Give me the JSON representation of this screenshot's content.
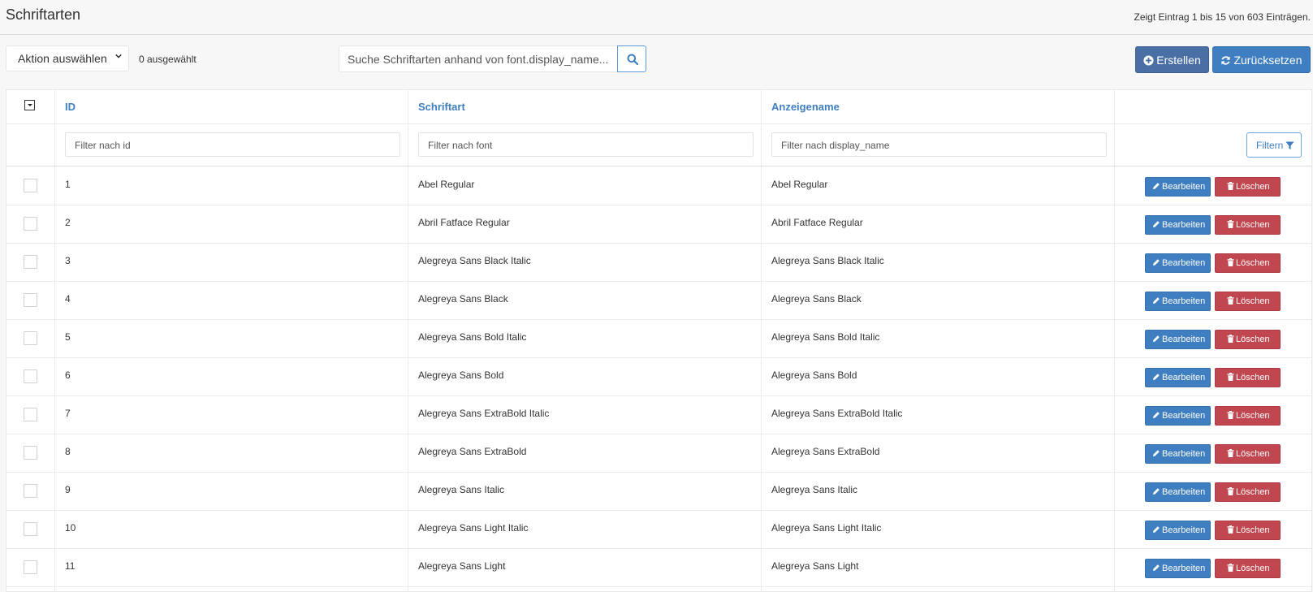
{
  "header": {
    "title": "Schriftarten",
    "entries_info": "Zeigt Eintrag 1 bis 15 von 603 Einträgen."
  },
  "toolbar": {
    "action_select": "Aktion auswählen",
    "selected_count": "0 ausgewählt",
    "search_placeholder": "Suche Schriftarten anhand von font.display_name...",
    "create_label": "Erstellen",
    "reset_label": "Zurücksetzen"
  },
  "table": {
    "columns": [
      "ID",
      "Schriftart",
      "Anzeigename"
    ],
    "filters": {
      "id": "Filter nach id",
      "font": "Filter nach font",
      "display_name": "Filter nach display_name",
      "button": "Filtern"
    },
    "edit_label": "Bearbeiten",
    "delete_label": "Löschen",
    "rows": [
      {
        "id": "1",
        "font": "Abel Regular",
        "display_name": "Abel Regular"
      },
      {
        "id": "2",
        "font": "Abril Fatface Regular",
        "display_name": "Abril Fatface Regular"
      },
      {
        "id": "3",
        "font": "Alegreya Sans Black Italic",
        "display_name": "Alegreya Sans Black Italic"
      },
      {
        "id": "4",
        "font": "Alegreya Sans Black",
        "display_name": "Alegreya Sans Black"
      },
      {
        "id": "5",
        "font": "Alegreya Sans Bold Italic",
        "display_name": "Alegreya Sans Bold Italic"
      },
      {
        "id": "6",
        "font": "Alegreya Sans Bold",
        "display_name": "Alegreya Sans Bold"
      },
      {
        "id": "7",
        "font": "Alegreya Sans ExtraBold Italic",
        "display_name": "Alegreya Sans ExtraBold Italic"
      },
      {
        "id": "8",
        "font": "Alegreya Sans ExtraBold",
        "display_name": "Alegreya Sans ExtraBold"
      },
      {
        "id": "9",
        "font": "Alegreya Sans Italic",
        "display_name": "Alegreya Sans Italic"
      },
      {
        "id": "10",
        "font": "Alegreya Sans Light Italic",
        "display_name": "Alegreya Sans Light Italic"
      },
      {
        "id": "11",
        "font": "Alegreya Sans Light",
        "display_name": "Alegreya Sans Light"
      }
    ]
  },
  "colors": {
    "primary": "#3f7fc1",
    "create": "#4a6fa5",
    "danger": "#c0464f"
  }
}
